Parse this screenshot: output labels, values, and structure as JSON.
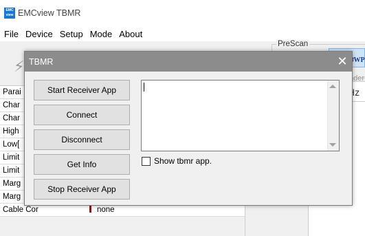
{
  "app": {
    "title": "EMCview TBMR",
    "icon_text": "EMC view"
  },
  "menu": [
    "File",
    "Device",
    "Setup",
    "Mode",
    "About"
  ],
  "toolbar": {
    "prescan_label": "PreScan",
    "swp_label": "SWP",
    "loader_text": "ader"
  },
  "hz_text": "Hz",
  "params": [
    {
      "label": "Parai",
      "value": ""
    },
    {
      "label": "Char",
      "value": ""
    },
    {
      "label": "Char",
      "value": ""
    },
    {
      "label": "High",
      "value": ""
    },
    {
      "label": "Low[",
      "value": ""
    },
    {
      "label": "Limit",
      "value": ""
    },
    {
      "label": "Limit",
      "value": ""
    },
    {
      "label": "Marg",
      "value": ""
    },
    {
      "label": "Marg",
      "value": ""
    },
    {
      "label": "Cable Cor",
      "value": "none"
    }
  ],
  "dialog": {
    "title": "TBMR",
    "close": "✕",
    "buttons": {
      "start": "Start Receiver App",
      "connect": "Connect",
      "disconnect": "Disconnect",
      "getinfo": "Get Info",
      "stop": "Stop Receiver App"
    },
    "output_text": "",
    "checkbox_label": "Show tbmr app.",
    "checkbox_checked": false
  }
}
